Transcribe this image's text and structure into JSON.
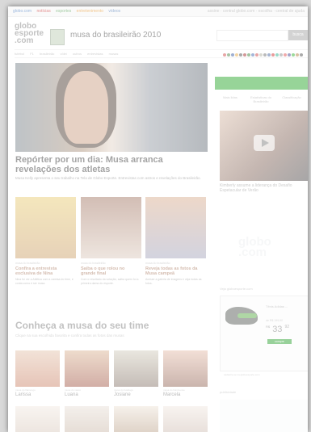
{
  "topbar": {
    "links": [
      "globo.com",
      "notícias",
      "esportes",
      "entretenimento",
      "vídeos"
    ],
    "link_colors": [
      "#1f5fb5",
      "#c20000",
      "#2f8a2f",
      "#e38100",
      "#2a5ea6"
    ],
    "right_text": "assine · central globo.com · escolha · central de ajuda"
  },
  "brand": {
    "line1": "globo",
    "line2": "esporte",
    "line3": ".com"
  },
  "header": {
    "title": "musa do brasileirão 2010",
    "search_placeholder": "",
    "search_button": "busca"
  },
  "subnav": {
    "items": [
      "futebol",
      "F1",
      "brasileirão",
      "vôlei",
      "outros",
      "entrevistas",
      "musas"
    ],
    "dot_colors": [
      "#c93a3a",
      "#3a7c3a",
      "#2a4f9a",
      "#e6a233",
      "#444",
      "#9b1b1b",
      "#2d7d2d",
      "#355ea8",
      "#c93a3a",
      "#aa9",
      "#666",
      "#3b5b9a",
      "#c22",
      "#2a8",
      "#888",
      "#d44",
      "#338",
      "#2a2",
      "#a73",
      "#444"
    ]
  },
  "hero": {
    "title": "Repórter por um dia: Musa arranca revelações dos atletas",
    "desc": "Musa Kelly apresenta o seu trabalho na Tela de Globo Esporte. Entrevistas com astros e revelações do Brasileirão."
  },
  "features": [
    {
      "kicker": "musa do brasileirão",
      "title": "Confira a entrevista exclusiva de Nina",
      "body": "Nina foi ver a Atlética com a camisa do time, e conta como é ser musa."
    },
    {
      "kicker": "musa do brasileirão",
      "title": "Saiba o que rolou no grande final",
      "body": "Com o resultado da votação, saiba quem foi a primeira dama do esporte."
    },
    {
      "kicker": "musa do brasileirão",
      "title": "Reveja todas as fotos da Musa campeã",
      "body": "Acesse a galeria de imagens e veja todas as fotos."
    }
  ],
  "muse_section": {
    "heading": "Conheça a musa do seu time",
    "subtitle": "Clique na sua escolhida favorita e confira todas as fotos das musas",
    "cards": [
      {
        "team": "musa do flamengo",
        "name": "Larissa"
      },
      {
        "team": "musa do vasco",
        "name": "Luana"
      },
      {
        "team": "musa do botafogo",
        "name": "Josiane"
      },
      {
        "team": "musa do fluminense",
        "name": "Marcela"
      }
    ],
    "second_row_count": 4
  },
  "sidebar": {
    "tabs": [
      {
        "label": "Mais lidas"
      },
      {
        "label": "Estatísticas do Brasileirão"
      },
      {
        "label": "Classificação"
      }
    ],
    "video_caption": "Kimberly assume a liderança do Desafio Espetacular de Verão",
    "globo_watermark_line1": "globo",
    "globo_watermark_line2": ".com",
    "ad_label": "Veja globoesporte.com",
    "ad": {
      "product": "Tênis Adidas ...",
      "old_price": "de R$ 199,90",
      "price_prefix": "R$",
      "price_integer": "33",
      "price_cents": "92",
      "buy_label": "compre",
      "footer": "cadastre-se na globoesporte.com"
    },
    "publicidade_label": "publicidade"
  }
}
